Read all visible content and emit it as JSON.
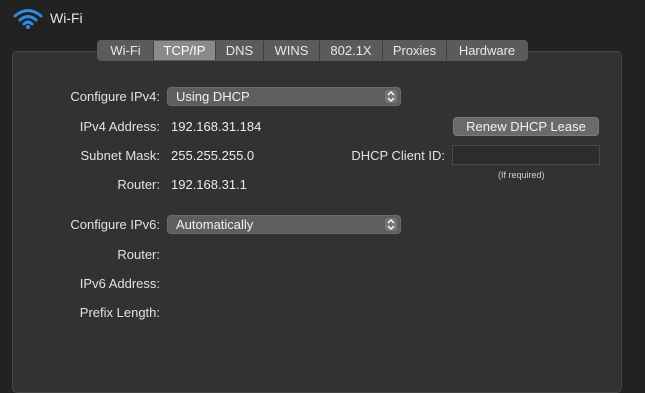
{
  "header": {
    "title": "Wi-Fi",
    "icon": "wifi-icon"
  },
  "tabs": [
    {
      "label": "Wi-Fi",
      "active": false
    },
    {
      "label": "TCP/IP",
      "active": true
    },
    {
      "label": "DNS",
      "active": false
    },
    {
      "label": "WINS",
      "active": false
    },
    {
      "label": "802.1X",
      "active": false
    },
    {
      "label": "Proxies",
      "active": false
    },
    {
      "label": "Hardware",
      "active": false
    }
  ],
  "ipv4": {
    "configure_label": "Configure IPv4:",
    "configure_value": "Using DHCP",
    "address_label": "IPv4 Address:",
    "address_value": "192.168.31.184",
    "subnet_label": "Subnet Mask:",
    "subnet_value": "255.255.255.0",
    "router_label": "Router:",
    "router_value": "192.168.31.1",
    "renew_button": "Renew DHCP Lease",
    "client_id_label": "DHCP Client ID:",
    "client_id_value": "",
    "client_id_hint": "(If required)"
  },
  "ipv6": {
    "configure_label": "Configure IPv6:",
    "configure_value": "Automatically",
    "router_label": "Router:",
    "address_label": "IPv6 Address:",
    "prefix_label": "Prefix Length:"
  }
}
